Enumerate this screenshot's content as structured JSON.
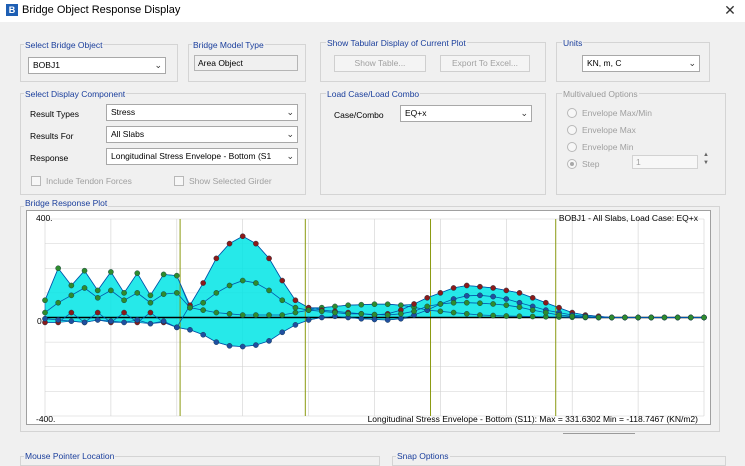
{
  "window": {
    "icon_letter": "B",
    "title": "Bridge Object Response Display",
    "close_glyph": "✕"
  },
  "select_bridge_object": {
    "legend": "Select Bridge Object",
    "value": "BOBJ1"
  },
  "bridge_model_type": {
    "legend": "Bridge Model Type",
    "value": "Area Object"
  },
  "tabular": {
    "legend": "Show Tabular Display of Current Plot",
    "show_table": "Show Table...",
    "export_excel": "Export To Excel..."
  },
  "units": {
    "legend": "Units",
    "value": "KN, m, C"
  },
  "display_component": {
    "legend": "Select Display Component",
    "result_types_label": "Result Types",
    "result_types_value": "Stress",
    "results_for_label": "Results For",
    "results_for_value": "All Slabs",
    "response_label": "Response",
    "response_value": "Longitudinal Stress Envelope - Bottom (S1",
    "include_tendon": "Include Tendon Forces",
    "show_girder": "Show Selected Girder"
  },
  "load_case": {
    "legend": "Load Case/Load Combo",
    "label": "Case/Combo",
    "value": "EQ+x"
  },
  "multivalued": {
    "legend": "Multivalued Options",
    "envelope_maxmin": "Envelope Max/Min",
    "envelope_max": "Envelope Max",
    "envelope_min": "Envelope Min",
    "step": "Step",
    "step_value": "1"
  },
  "plot": {
    "legend": "Bridge Response Plot",
    "ymax_label": "400.",
    "zero_label": "0",
    "ymin_label": "-400.",
    "header": "BOBJ1 - All Slabs,  Load Case: EQ+x",
    "footer": "Longitudinal Stress Envelope - Bottom (S11):  Max = 331.6302    Min = -118.7467  (KN/m2)"
  },
  "bottom": {
    "mouse_legend": "Mouse Pointer Location",
    "snap_legend": "Snap Options"
  },
  "chart_data": {
    "type": "line",
    "title": "BOBJ1 - All Slabs,  Load Case: EQ+x",
    "ylim": [
      -400,
      400
    ],
    "y_tick_labels": [
      "400.",
      "0",
      "-400."
    ],
    "max_value": 331.6302,
    "min_value": -118.7467,
    "units": "KN/m2",
    "grid": true,
    "colors": {
      "fill": "#00e5e5",
      "outline": "#0055aa",
      "dot_green": "#2e8b2e",
      "dot_red": "#8b1a1a",
      "dot_blue": "#1f4fa0",
      "axis": "#000000",
      "span_line": "#8a9a10",
      "grid": "#d0d0d0"
    },
    "x": [
      0,
      0.02,
      0.04,
      0.06,
      0.08,
      0.1,
      0.12,
      0.14,
      0.16,
      0.18,
      0.2,
      0.22,
      0.24,
      0.26,
      0.28,
      0.3,
      0.32,
      0.34,
      0.36,
      0.38,
      0.4,
      0.42,
      0.44,
      0.46,
      0.48,
      0.5,
      0.52,
      0.54,
      0.56,
      0.58,
      0.6,
      0.62,
      0.64,
      0.66,
      0.68,
      0.7,
      0.72,
      0.74,
      0.76,
      0.78,
      0.8,
      0.82,
      0.84,
      0.86,
      0.88,
      0.9,
      0.92,
      0.94,
      0.96,
      0.98,
      1.0
    ],
    "span_boundaries": [
      0.205,
      0.395,
      0.585,
      0.775
    ],
    "series": [
      {
        "values": [
          70,
          200,
          130,
          190,
          110,
          185,
          100,
          180,
          90,
          175,
          170,
          40,
          30,
          20,
          15,
          10,
          10,
          10,
          10,
          20,
          30,
          40,
          45,
          50,
          52,
          54,
          54,
          50,
          42,
          30,
          25,
          20,
          15,
          10,
          8,
          6,
          5,
          4,
          3,
          2,
          1,
          0,
          0,
          0,
          0,
          0,
          0,
          0,
          0,
          0,
          0
        ]
      },
      {
        "values": [
          -20,
          -20,
          20,
          -20,
          20,
          -20,
          20,
          -20,
          20,
          -20,
          -40,
          50,
          140,
          240,
          300,
          330,
          300,
          240,
          150,
          70,
          40,
          30,
          25,
          20,
          15,
          10,
          15,
          30,
          55,
          80,
          100,
          120,
          130,
          125,
          120,
          110,
          100,
          80,
          60,
          40,
          20,
          10,
          5,
          0,
          0,
          0,
          0,
          0,
          0,
          0,
          0
        ]
      },
      {
        "values": [
          -5,
          -10,
          -15,
          -20,
          -10,
          -15,
          -20,
          -10,
          -25,
          -15,
          -40,
          -50,
          -70,
          -100,
          -115,
          -118,
          -112,
          -95,
          -60,
          -30,
          -10,
          0,
          5,
          0,
          -5,
          -8,
          -10,
          -5,
          10,
          30,
          55,
          75,
          88,
          90,
          85,
          75,
          60,
          45,
          30,
          20,
          10,
          5,
          0,
          0,
          0,
          0,
          0,
          0,
          0,
          0,
          0
        ]
      },
      {
        "values": [
          20,
          60,
          90,
          120,
          80,
          110,
          70,
          100,
          60,
          95,
          100,
          40,
          60,
          100,
          130,
          150,
          140,
          110,
          70,
          40,
          30,
          25,
          20,
          15,
          15,
          12,
          10,
          15,
          25,
          45,
          55,
          60,
          60,
          58,
          55,
          50,
          42,
          30,
          20,
          10,
          5,
          2,
          0,
          0,
          0,
          0,
          0,
          0,
          0,
          0,
          0
        ]
      }
    ]
  }
}
